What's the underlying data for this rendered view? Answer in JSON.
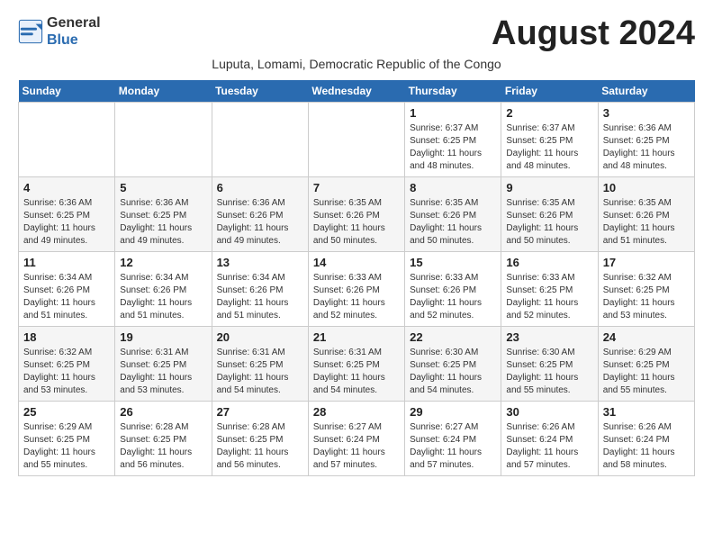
{
  "header": {
    "logo_general": "General",
    "logo_blue": "Blue",
    "title": "August 2024",
    "subtitle": "Luputa, Lomami, Democratic Republic of the Congo"
  },
  "weekdays": [
    "Sunday",
    "Monday",
    "Tuesday",
    "Wednesday",
    "Thursday",
    "Friday",
    "Saturday"
  ],
  "weeks": [
    [
      {
        "day": "",
        "info": ""
      },
      {
        "day": "",
        "info": ""
      },
      {
        "day": "",
        "info": ""
      },
      {
        "day": "",
        "info": ""
      },
      {
        "day": "1",
        "info": "Sunrise: 6:37 AM\nSunset: 6:25 PM\nDaylight: 11 hours and 48 minutes."
      },
      {
        "day": "2",
        "info": "Sunrise: 6:37 AM\nSunset: 6:25 PM\nDaylight: 11 hours and 48 minutes."
      },
      {
        "day": "3",
        "info": "Sunrise: 6:36 AM\nSunset: 6:25 PM\nDaylight: 11 hours and 48 minutes."
      }
    ],
    [
      {
        "day": "4",
        "info": "Sunrise: 6:36 AM\nSunset: 6:25 PM\nDaylight: 11 hours and 49 minutes."
      },
      {
        "day": "5",
        "info": "Sunrise: 6:36 AM\nSunset: 6:25 PM\nDaylight: 11 hours and 49 minutes."
      },
      {
        "day": "6",
        "info": "Sunrise: 6:36 AM\nSunset: 6:26 PM\nDaylight: 11 hours and 49 minutes."
      },
      {
        "day": "7",
        "info": "Sunrise: 6:35 AM\nSunset: 6:26 PM\nDaylight: 11 hours and 50 minutes."
      },
      {
        "day": "8",
        "info": "Sunrise: 6:35 AM\nSunset: 6:26 PM\nDaylight: 11 hours and 50 minutes."
      },
      {
        "day": "9",
        "info": "Sunrise: 6:35 AM\nSunset: 6:26 PM\nDaylight: 11 hours and 50 minutes."
      },
      {
        "day": "10",
        "info": "Sunrise: 6:35 AM\nSunset: 6:26 PM\nDaylight: 11 hours and 51 minutes."
      }
    ],
    [
      {
        "day": "11",
        "info": "Sunrise: 6:34 AM\nSunset: 6:26 PM\nDaylight: 11 hours and 51 minutes."
      },
      {
        "day": "12",
        "info": "Sunrise: 6:34 AM\nSunset: 6:26 PM\nDaylight: 11 hours and 51 minutes."
      },
      {
        "day": "13",
        "info": "Sunrise: 6:34 AM\nSunset: 6:26 PM\nDaylight: 11 hours and 51 minutes."
      },
      {
        "day": "14",
        "info": "Sunrise: 6:33 AM\nSunset: 6:26 PM\nDaylight: 11 hours and 52 minutes."
      },
      {
        "day": "15",
        "info": "Sunrise: 6:33 AM\nSunset: 6:26 PM\nDaylight: 11 hours and 52 minutes."
      },
      {
        "day": "16",
        "info": "Sunrise: 6:33 AM\nSunset: 6:25 PM\nDaylight: 11 hours and 52 minutes."
      },
      {
        "day": "17",
        "info": "Sunrise: 6:32 AM\nSunset: 6:25 PM\nDaylight: 11 hours and 53 minutes."
      }
    ],
    [
      {
        "day": "18",
        "info": "Sunrise: 6:32 AM\nSunset: 6:25 PM\nDaylight: 11 hours and 53 minutes."
      },
      {
        "day": "19",
        "info": "Sunrise: 6:31 AM\nSunset: 6:25 PM\nDaylight: 11 hours and 53 minutes."
      },
      {
        "day": "20",
        "info": "Sunrise: 6:31 AM\nSunset: 6:25 PM\nDaylight: 11 hours and 54 minutes."
      },
      {
        "day": "21",
        "info": "Sunrise: 6:31 AM\nSunset: 6:25 PM\nDaylight: 11 hours and 54 minutes."
      },
      {
        "day": "22",
        "info": "Sunrise: 6:30 AM\nSunset: 6:25 PM\nDaylight: 11 hours and 54 minutes."
      },
      {
        "day": "23",
        "info": "Sunrise: 6:30 AM\nSunset: 6:25 PM\nDaylight: 11 hours and 55 minutes."
      },
      {
        "day": "24",
        "info": "Sunrise: 6:29 AM\nSunset: 6:25 PM\nDaylight: 11 hours and 55 minutes."
      }
    ],
    [
      {
        "day": "25",
        "info": "Sunrise: 6:29 AM\nSunset: 6:25 PM\nDaylight: 11 hours and 55 minutes."
      },
      {
        "day": "26",
        "info": "Sunrise: 6:28 AM\nSunset: 6:25 PM\nDaylight: 11 hours and 56 minutes."
      },
      {
        "day": "27",
        "info": "Sunrise: 6:28 AM\nSunset: 6:25 PM\nDaylight: 11 hours and 56 minutes."
      },
      {
        "day": "28",
        "info": "Sunrise: 6:27 AM\nSunset: 6:24 PM\nDaylight: 11 hours and 57 minutes."
      },
      {
        "day": "29",
        "info": "Sunrise: 6:27 AM\nSunset: 6:24 PM\nDaylight: 11 hours and 57 minutes."
      },
      {
        "day": "30",
        "info": "Sunrise: 6:26 AM\nSunset: 6:24 PM\nDaylight: 11 hours and 57 minutes."
      },
      {
        "day": "31",
        "info": "Sunrise: 6:26 AM\nSunset: 6:24 PM\nDaylight: 11 hours and 58 minutes."
      }
    ]
  ]
}
